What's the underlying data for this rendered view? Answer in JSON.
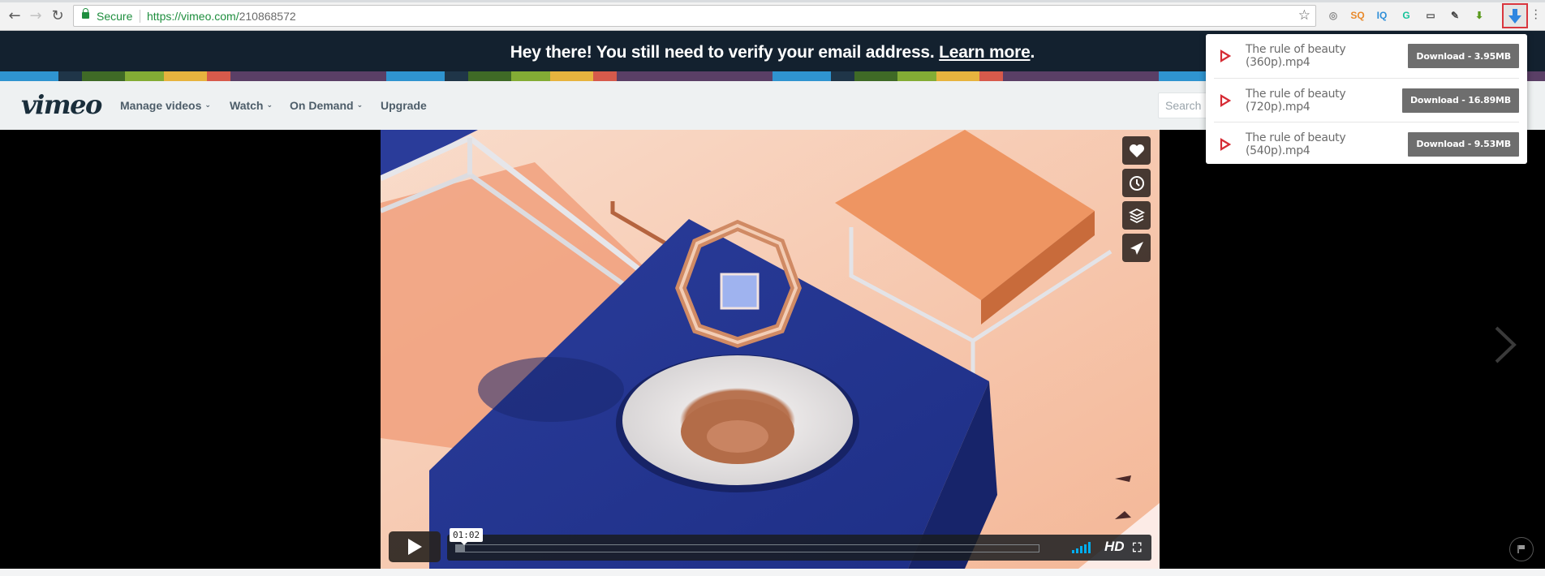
{
  "browser": {
    "secure_label": "Secure",
    "url_host": "https://vimeo.com/",
    "url_path": "210868572",
    "extensions": [
      {
        "name": "target-extension-icon",
        "glyph": "◎",
        "color": "#8a8a8a"
      },
      {
        "name": "sq-extension-icon",
        "glyph": "SQ",
        "color": "#e8892b"
      },
      {
        "name": "iq-extension-icon",
        "glyph": "IQ",
        "color": "#2f8fd8"
      },
      {
        "name": "grammarly-icon",
        "glyph": "G",
        "color": "#15c39a"
      },
      {
        "name": "cast-icon",
        "glyph": "▭",
        "color": "#555555"
      },
      {
        "name": "bird-extension-icon",
        "glyph": "✎",
        "color": "#444444"
      },
      {
        "name": "green-download-extension-icon",
        "glyph": "⬇",
        "color": "#5a9a1e"
      }
    ],
    "active_extension": "video-downloader-icon"
  },
  "banner": {
    "message": "Hey there! You still need to verify your email address. ",
    "link_label": "Learn more",
    "trailing": ".",
    "stripe_colors": [
      "#2f94d0",
      "#1f3548",
      "#3f6a26",
      "#83ac35",
      "#e7b33e",
      "#d65a4b",
      "#5a3f66"
    ]
  },
  "nav": {
    "logo": "vimeo",
    "items": [
      {
        "label": "Manage videos",
        "dropdown": true
      },
      {
        "label": "Watch",
        "dropdown": true
      },
      {
        "label": "On Demand",
        "dropdown": true
      },
      {
        "label": "Upgrade",
        "dropdown": false
      }
    ],
    "search_placeholder": "Search"
  },
  "player": {
    "current_time": "01:02",
    "progress_fraction": 0.015,
    "quality_badge": "HD",
    "side_actions": [
      "like",
      "watch-later",
      "collections",
      "share"
    ],
    "volume_bars": 5
  },
  "download_popup": {
    "items": [
      {
        "filename": "The rule of beauty (360p).mp4",
        "button_label": "Download - 3.95MB"
      },
      {
        "filename": "The rule of beauty (720p).mp4",
        "button_label": "Download - 16.89MB"
      },
      {
        "filename": "The rule of beauty (540p).mp4",
        "button_label": "Download - 9.53MB"
      }
    ],
    "accent": "#d62b34"
  }
}
